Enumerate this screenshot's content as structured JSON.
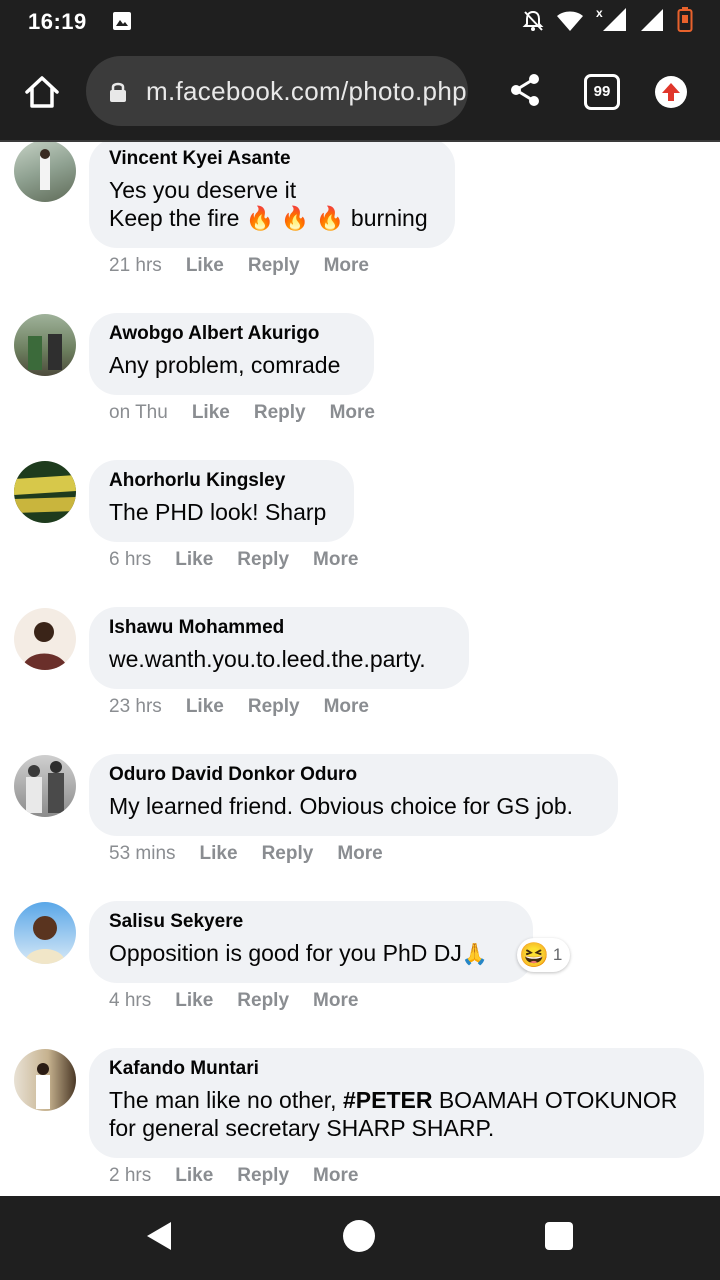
{
  "status_bar": {
    "time": "16:19",
    "icons": [
      "image-notification-icon",
      "mute-notifications-icon",
      "wifi-icon",
      "cell-signal-no-data-icon",
      "cell-signal-icon",
      "battery-low-icon"
    ]
  },
  "browser": {
    "url": "m.facebook.com/photo.php",
    "tab_count": "99",
    "icons": [
      "home-icon",
      "lock-icon",
      "share-icon",
      "tabs-icon",
      "upload-arrow-icon"
    ]
  },
  "comments": [
    {
      "author": "Vincent Kyei Asante",
      "line1": "Yes you deserve it",
      "line2_before": "Keep the fire ",
      "line2_emoji": "🔥 🔥 🔥",
      "line2_after": " burning",
      "time": "21 hrs",
      "like": "Like",
      "reply": "Reply",
      "more": "More"
    },
    {
      "author": "Awobgo Albert Akurigo",
      "text": "Any problem, comrade",
      "time": "on Thu",
      "like": "Like",
      "reply": "Reply",
      "more": "More"
    },
    {
      "author": "Ahorhorlu Kingsley",
      "text": "The PHD look! Sharp",
      "time": "6 hrs",
      "like": "Like",
      "reply": "Reply",
      "more": "More"
    },
    {
      "author": "Ishawu Mohammed",
      "text": "we.wanth.you.to.leed.the.party.",
      "time": "23 hrs",
      "like": "Like",
      "reply": "Reply",
      "more": "More"
    },
    {
      "author": "Oduro David Donkor Oduro",
      "text": "My learned friend. Obvious choice for GS job.",
      "time": "53 mins",
      "like": "Like",
      "reply": "Reply",
      "more": "More"
    },
    {
      "author": "Salisu Sekyere",
      "text": "Opposition is good for you PhD DJ",
      "text_emoji": "🙏",
      "reaction_emoji": "😆",
      "reaction_count": "1",
      "time": "4 hrs",
      "like": "Like",
      "reply": "Reply",
      "more": "More"
    },
    {
      "author": "Kafando Muntari",
      "text_before": "The man like no other, ",
      "text_hashtag": "#PETER",
      "text_after": " BOAMAH OTOKUNOR for general secretary SHARP SHARP.",
      "time": "2 hrs",
      "like": "Like",
      "reply": "Reply",
      "more": "More"
    }
  ],
  "nav_bar": {
    "icons": [
      "back-icon",
      "home-circle-icon",
      "recent-apps-icon"
    ]
  }
}
